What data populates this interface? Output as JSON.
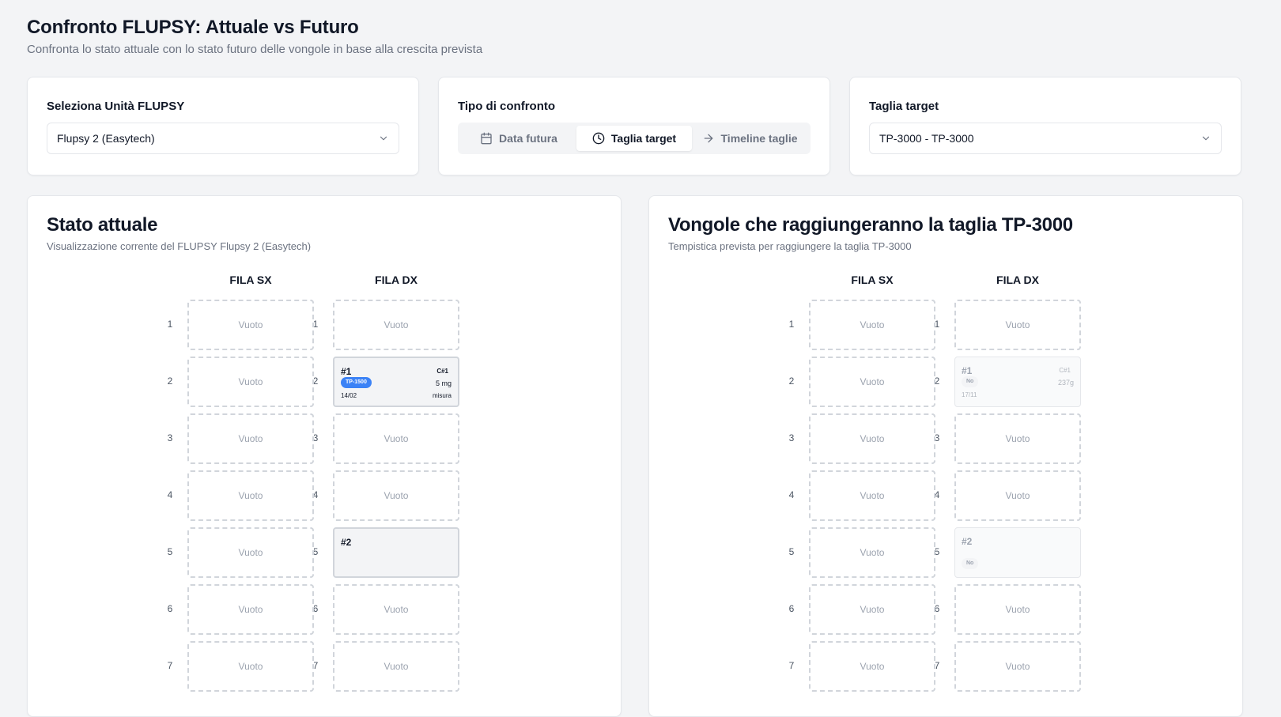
{
  "header": {
    "title": "Confronto FLUPSY: Attuale vs Futuro",
    "subtitle": "Confronta lo stato attuale con lo stato futuro delle vongole in base alla crescita prevista"
  },
  "controls": {
    "unit_label": "Seleziona Unità FLUPSY",
    "unit_value": "Flupsy 2 (Easytech)",
    "type_label": "Tipo di confronto",
    "type_options": [
      "Data futura",
      "Taglia target",
      "Timeline taglie"
    ],
    "type_selected": "Taglia target",
    "target_label": "Taglia target",
    "target_value": "TP-3000 - TP-3000"
  },
  "current": {
    "title": "Stato attuale",
    "subtitle": "Visualizzazione corrente del FLUPSY Flupsy 2 (Easytech)",
    "col_sx": "FILA SX",
    "col_dx": "FILA DX",
    "rows": [
      "1",
      "2",
      "3",
      "4",
      "5",
      "6",
      "7"
    ],
    "empty_label": "Vuoto",
    "basket1": {
      "id": "#1",
      "cycle": "C#1",
      "size": "TP-1500",
      "weight": "5 mg",
      "date": "14/02",
      "type": "misura"
    },
    "basket2": {
      "id": "#2"
    }
  },
  "future": {
    "title": "Vongole che raggiungeranno la taglia TP-3000",
    "subtitle": "Tempistica prevista per raggiungere la taglia TP-3000",
    "col_sx": "FILA SX",
    "col_dx": "FILA DX",
    "rows": [
      "1",
      "2",
      "3",
      "4",
      "5",
      "6",
      "7"
    ],
    "empty_label": "Vuoto",
    "basket1": {
      "id": "#1",
      "cycle": "C#1",
      "tag": "No",
      "weight": "237g",
      "date": "17/11"
    },
    "basket2": {
      "id": "#2",
      "tag": "No"
    }
  },
  "colors": {
    "accent": "#3b82f6",
    "background": "#f3f4f6",
    "border": "#e5e7eb"
  }
}
